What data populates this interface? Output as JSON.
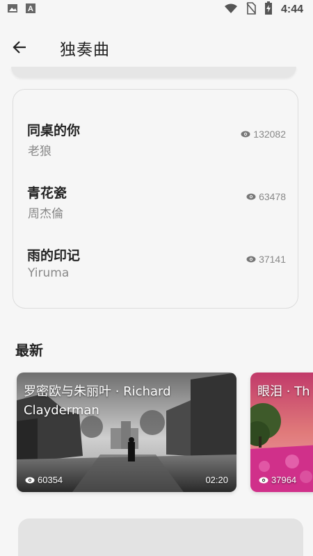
{
  "status_bar": {
    "time": "4:44",
    "icons": [
      "image-icon",
      "font-icon",
      "wifi-icon",
      "sim-off-icon",
      "battery-charging-icon"
    ]
  },
  "app_bar": {
    "title": "独奏曲",
    "back_icon": "arrow-left-icon"
  },
  "top_list": [
    {
      "title": "同桌的你",
      "artist": "老狼",
      "views": "132082"
    },
    {
      "title": "青花瓷",
      "artist": "周杰倫",
      "views": "63478"
    },
    {
      "title": "雨的印记",
      "artist": "Yiruma",
      "views": "37141"
    }
  ],
  "latest": {
    "heading": "最新",
    "cards": [
      {
        "title": "罗密欧与朱丽叶 · Richard Clayderman",
        "views": "60354",
        "duration": "02:20"
      },
      {
        "title": "眼泪 · Th",
        "views": "37964"
      }
    ]
  },
  "colors": {
    "background": "#f6f6f6",
    "muted_text": "#888888",
    "primary_text": "#222222"
  }
}
